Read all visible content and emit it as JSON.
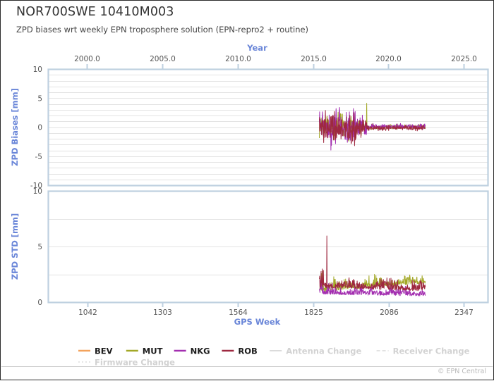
{
  "header": {
    "title": "NOR700SWE 10410M003",
    "subtitle": "ZPD biases wrt weekly EPN troposphere solution (EPN-repro2 + routine)"
  },
  "footer": {
    "copyright": "© EPN Central"
  },
  "legend": {
    "items": [
      {
        "label": "BEV",
        "color": "#f3a35c",
        "style": "solid",
        "muted": false
      },
      {
        "label": "MUT",
        "color": "#a3a827",
        "style": "solid",
        "muted": false
      },
      {
        "label": "NKG",
        "color": "#a32fb0",
        "style": "solid",
        "muted": false
      },
      {
        "label": "ROB",
        "color": "#9e2940",
        "style": "solid",
        "muted": false
      },
      {
        "label": "Antenna Change",
        "color": "#d6d6d6",
        "style": "solid",
        "muted": true
      },
      {
        "label": "Receiver Change",
        "color": "#dedede",
        "style": "dashed",
        "muted": true
      },
      {
        "label": "Firmware Change",
        "color": "#e2e2e2",
        "style": "dotted",
        "muted": true
      }
    ]
  },
  "chart_data": {
    "type": "line",
    "title": "NOR700SWE 10410M003",
    "subtitle": "ZPD biases wrt weekly EPN troposphere solution (EPN-repro2 + routine)",
    "top_axis": {
      "label": "Year",
      "ticks": [
        2000.0,
        2005.0,
        2010.0,
        2015.0,
        2020.0,
        2025.0
      ],
      "tick_labels": [
        "2000.0",
        "2005.0",
        "2010.0",
        "2015.0",
        "2020.0",
        "2025.0"
      ],
      "range": [
        1997.4,
        2026.6
      ]
    },
    "bottom_axis": {
      "label": "GPS Week",
      "ticks": [
        1042,
        1303,
        1564,
        1825,
        2086,
        2347
      ],
      "tick_labels": [
        "1042",
        "1303",
        "1564",
        "1825",
        "2086",
        "2347"
      ],
      "range": [
        906,
        2429
      ]
    },
    "panels": [
      {
        "name": "zpd-biases",
        "ylabel": "ZPD Biases [mm]",
        "ylim": [
          -10,
          10
        ],
        "yticks": [
          10,
          5,
          0,
          -5,
          -10
        ],
        "ytick_labels": [
          "10",
          "5",
          "0",
          "-5",
          "-10"
        ],
        "grid": true,
        "grid_step": 1,
        "series": [
          {
            "name": "BEV",
            "color": "#f3a35c",
            "x_start_week": 1846,
            "x_end_week": 2180,
            "n_points": 0,
            "note": "no visible data for this station"
          },
          {
            "name": "MUT",
            "color": "#a3a827",
            "x_start_week": 1846,
            "x_end_week": 2213,
            "mean": 0.05,
            "noise_early": 1.6,
            "noise_late": 0.35,
            "spike_week": 2010,
            "spike_value": 4.1
          },
          {
            "name": "NKG",
            "color": "#a32fb0",
            "x_start_week": 1846,
            "x_end_week": 2213,
            "mean": 0.1,
            "noise_early": 2.1,
            "noise_late": 0.35
          },
          {
            "name": "ROB",
            "color": "#9e2940",
            "x_start_week": 1846,
            "x_end_week": 2213,
            "mean": -0.15,
            "noise_early": 2.2,
            "noise_late": 0.35
          }
        ]
      },
      {
        "name": "zpd-std",
        "ylabel": "ZPD STD [mm]",
        "ylim": [
          0,
          10
        ],
        "yticks": [
          10,
          5,
          0
        ],
        "ytick_labels": [
          "10",
          "5",
          "0"
        ],
        "grid": true,
        "grid_step": 2.5,
        "series": [
          {
            "name": "MUT",
            "color": "#a3a827",
            "x_start_week": 1846,
            "x_end_week": 2213,
            "baseline_early": 0.9,
            "baseline_late": 1.7,
            "peak": 3.2
          },
          {
            "name": "NKG",
            "color": "#a32fb0",
            "x_start_week": 1846,
            "x_end_week": 2213,
            "baseline_early": 0.7,
            "baseline_late": 0.55,
            "peak": 2.2
          },
          {
            "name": "ROB",
            "color": "#9e2940",
            "x_start_week": 1846,
            "x_end_week": 2213,
            "baseline_early": 1.3,
            "baseline_late": 1.0,
            "peak": 3.0,
            "spike_week": 1872,
            "spike_value": 5.95
          }
        ]
      }
    ]
  }
}
